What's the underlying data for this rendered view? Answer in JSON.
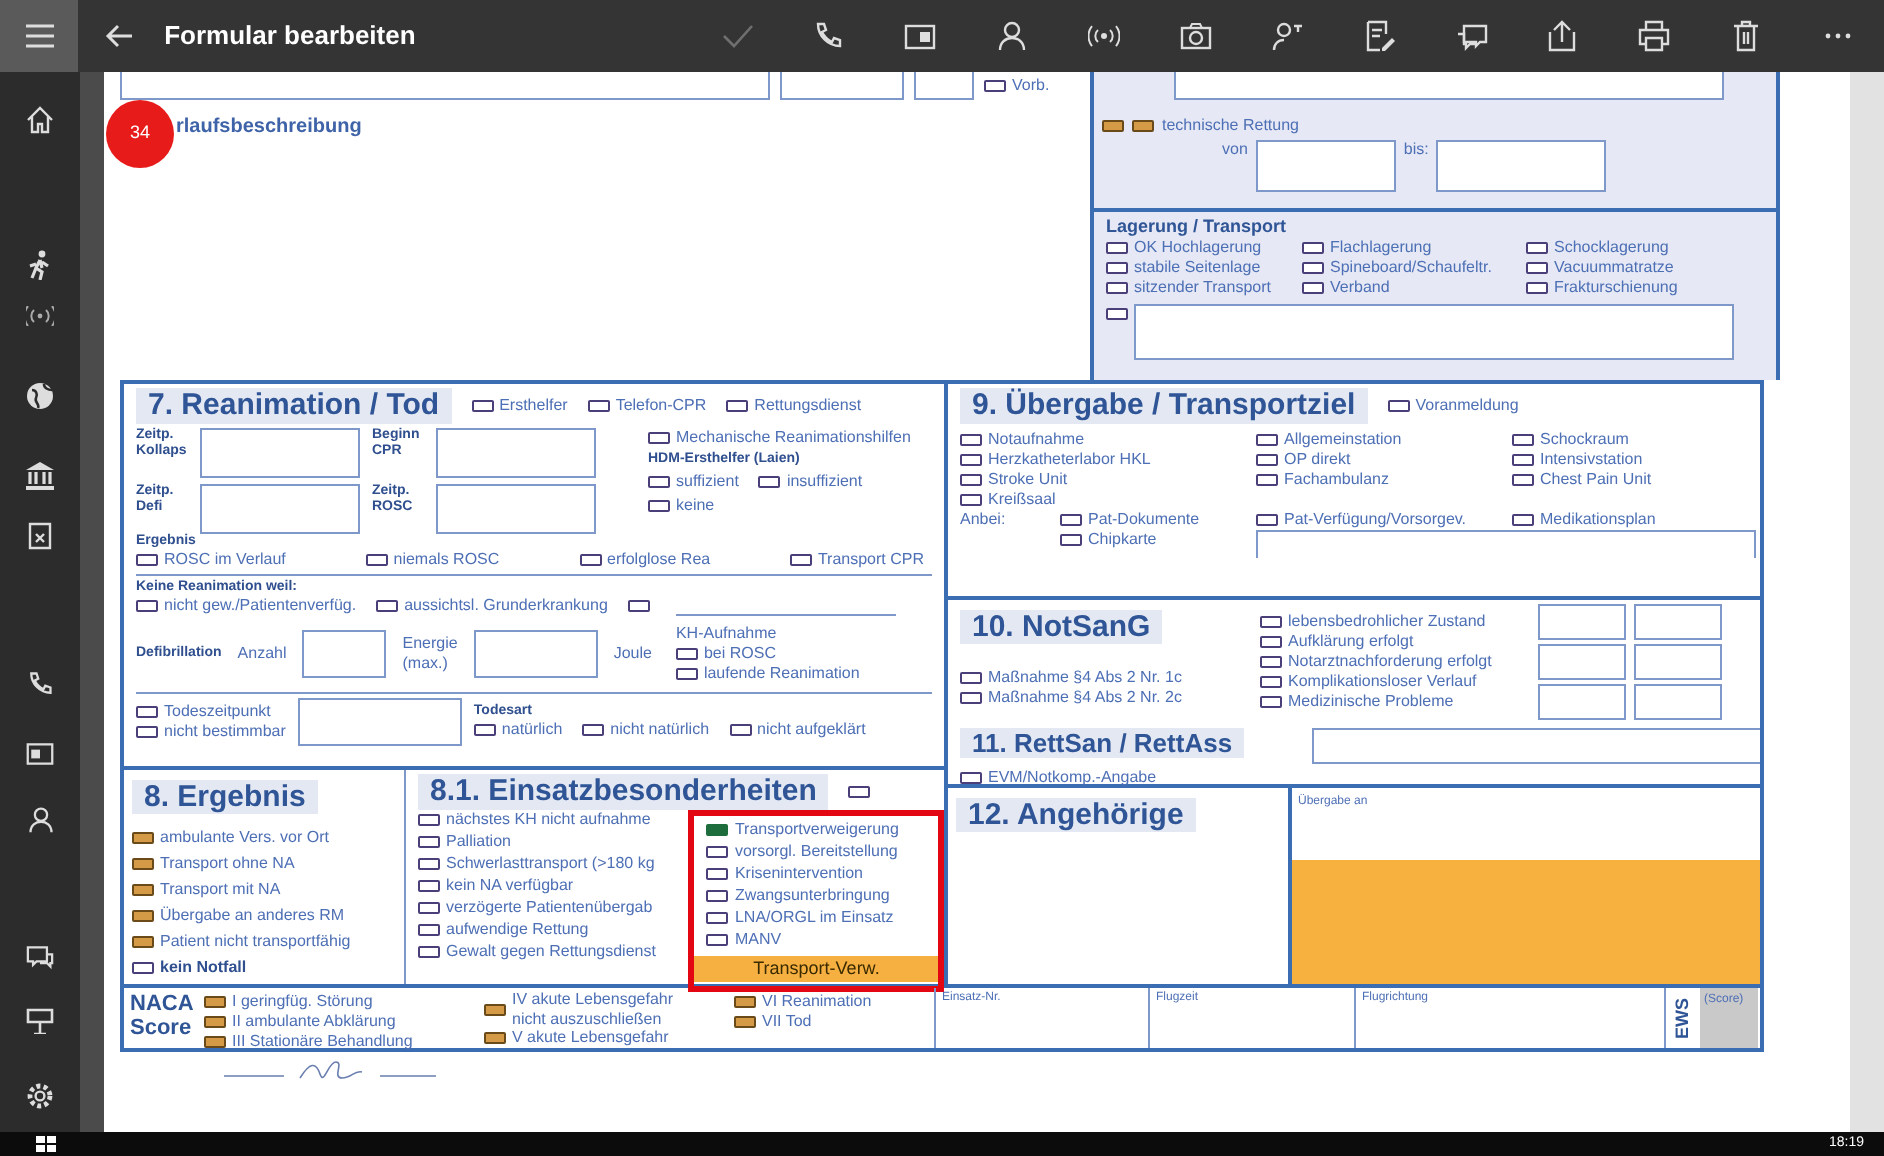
{
  "app_bar": {
    "title": "Formular bearbeiten",
    "confirm_disabled": true
  },
  "badge": "34",
  "top": {
    "title": "rlaufsbeschreibung",
    "vorb": {
      "label": "Vorb.",
      "checked": false
    },
    "technische_rettung": {
      "label": "technische Rettung",
      "boxes": [
        {
          "checked": false,
          "color": "#d49a45"
        },
        {
          "checked": false,
          "color": "#d49a45"
        }
      ],
      "from": "von",
      "to": "bis:"
    }
  },
  "lagerung": {
    "title": "Lagerung / Transport",
    "columns": [
      [
        {
          "label": "OK Hochlagerung",
          "checked": false
        },
        {
          "label": "stabile Seitenlage",
          "checked": false
        },
        {
          "label": "sitzender Transport",
          "checked": false
        }
      ],
      [
        {
          "label": "Flachlagerung",
          "checked": false
        },
        {
          "label": "Spineboard/Schaufeltr.",
          "checked": false
        },
        {
          "label": "Verband",
          "checked": false
        }
      ],
      [
        {
          "label": "Schocklagerung",
          "checked": false
        },
        {
          "label": "Vacuummatratze",
          "checked": false
        },
        {
          "label": "Frakturschienung",
          "checked": false
        }
      ]
    ],
    "other": {
      "checked": false
    }
  },
  "reanimation": {
    "title": "7. Reanimation / Tod",
    "header_options": [
      {
        "label": "Ersthelfer",
        "checked": false
      },
      {
        "label": "Telefon-CPR",
        "checked": false
      },
      {
        "label": "Rettungsdienst",
        "checked": false
      }
    ],
    "times": [
      "Zeitp.\nKollaps",
      "Beginn\nCPR",
      "Zeitp.\nDefi",
      "Zeitp.\nROSC"
    ],
    "mech": {
      "label": "Mechanische Reanimationshilfen",
      "checked": false
    },
    "hdm_title": "HDM-Ersthelfer (Laien)",
    "hdm": [
      {
        "label": "suffizient",
        "checked": false
      },
      {
        "label": "insuffizient",
        "checked": false
      },
      {
        "label": "keine",
        "checked": false
      }
    ],
    "result_title": "Ergebnis",
    "results": [
      {
        "label": "ROSC im Verlauf",
        "checked": false
      },
      {
        "label": "niemals ROSC",
        "checked": false
      },
      {
        "label": "erfolglose Rea",
        "checked": false
      },
      {
        "label": "Transport CPR",
        "checked": false
      }
    ],
    "no_rea_title": "Keine Reanimation weil:",
    "no_rea": [
      {
        "label": "nicht gew./Patientenverfüg.",
        "checked": false
      },
      {
        "label": "aussichtsl. Grunderkrankung",
        "checked": false
      },
      {
        "checked": false
      }
    ],
    "defi": {
      "title": "Defibrillation",
      "count": "Anzahl",
      "energy": "Energie\n(max.)",
      "unit": "Joule"
    },
    "kh": {
      "title": "KH-Aufnahme",
      "options": [
        {
          "label": "bei ROSC",
          "checked": false
        },
        {
          "label": "laufende Reanimation",
          "checked": false
        }
      ]
    },
    "death": {
      "options": [
        {
          "label": "Todeszeitpunkt",
          "checked": false
        },
        {
          "label": "nicht bestimmbar",
          "checked": false
        }
      ],
      "type_title": "Todesart",
      "types": [
        {
          "label": "natürlich",
          "checked": false
        },
        {
          "label": "nicht natürlich",
          "checked": false
        },
        {
          "label": "nicht aufgeklärt",
          "checked": false
        }
      ]
    }
  },
  "uebergabe": {
    "title": "9. Übergabe / Transportziel",
    "prenotice": {
      "label": "Voranmeldung",
      "checked": false
    },
    "columns": [
      [
        {
          "label": "Notaufnahme",
          "checked": false
        },
        {
          "label": "Herzkatheterlabor HKL",
          "checked": false
        },
        {
          "label": "Stroke Unit",
          "checked": false
        },
        {
          "label": "Kreißsaal",
          "checked": false
        }
      ],
      [
        {
          "label": "Allgemeinstation",
          "checked": false
        },
        {
          "label": "OP direkt",
          "checked": false
        },
        {
          "label": "Fachambulanz",
          "checked": false
        }
      ],
      [
        {
          "label": "Schockraum",
          "checked": false
        },
        {
          "label": "Intensivstation",
          "checked": false
        },
        {
          "label": "Chest Pain Unit",
          "checked": false
        }
      ]
    ],
    "attached_label": "Anbei:",
    "attached": [
      [
        {
          "label": "Pat-Dokumente",
          "checked": false
        },
        {
          "label": "Chipkarte",
          "checked": false
        }
      ],
      [
        {
          "label": "Pat-Verfügung/Vorsorgev.",
          "checked": false
        }
      ],
      [
        {
          "label": "Medikationsplan",
          "checked": false
        }
      ]
    ]
  },
  "notsang": {
    "title": "10. NotSanG",
    "measures": [
      {
        "label": "Maßnahme §4 Abs 2 Nr. 1c",
        "checked": false
      },
      {
        "label": "Maßnahme §4 Abs 2 Nr. 2c",
        "checked": false
      }
    ],
    "checks": [
      {
        "label": "lebensbedrohlicher Zustand",
        "checked": false
      },
      {
        "label": "Aufklärung erfolgt",
        "checked": false
      },
      {
        "label": "Notarztnachforderung erfolgt",
        "checked": false
      },
      {
        "label": "Komplikationsloser Verlauf",
        "checked": false
      },
      {
        "label": "Medizinische Probleme",
        "checked": false
      }
    ]
  },
  "rettsan": {
    "title": "11. RettSan / RettAss",
    "option": {
      "label": "EVM/Notkomp.-Angabe",
      "checked": false
    }
  },
  "ergebnis": {
    "title": "8. Ergebnis",
    "options": [
      {
        "label": "ambulante Vers. vor Ort",
        "checked": false,
        "color": "#d49a45",
        "bold": false
      },
      {
        "label": "Transport ohne NA",
        "checked": false,
        "color": "#d49a45",
        "bold": false
      },
      {
        "label": "Transport mit NA",
        "checked": false,
        "color": "#d49a45",
        "bold": false
      },
      {
        "label": "Übergabe an anderes RM",
        "checked": false,
        "color": "#d49a45",
        "bold": false
      },
      {
        "label": "Patient nicht transportfähig",
        "checked": false,
        "color": "#d49a45",
        "bold": false
      },
      {
        "label": "kein Notfall",
        "checked": false,
        "bold": true
      }
    ]
  },
  "besonderheiten": {
    "title": "8.1. Einsatzbesonderheiten",
    "none": {
      "checked": false
    },
    "left": [
      {
        "label": "nächstes KH nicht aufnahme",
        "checked": false
      },
      {
        "label": "Palliation",
        "checked": false
      },
      {
        "label": "Schwerlasttransport (>180 kg",
        "checked": false
      },
      {
        "label": "kein NA verfügbar",
        "checked": false
      },
      {
        "label": "verzögerte Patientenübergab",
        "checked": false
      },
      {
        "label": "aufwendige Rettung",
        "checked": false
      },
      {
        "label": "Gewalt gegen Rettungsdienst",
        "checked": false
      }
    ],
    "right": [
      {
        "label": "Transportverweigerung",
        "checked": true
      },
      {
        "label": "vorsorgl. Bereitstellung",
        "checked": false
      },
      {
        "label": "Krisenintervention",
        "checked": false
      },
      {
        "label": "Zwangsunterbringung",
        "checked": false
      },
      {
        "label": "LNA/ORGL im Einsatz",
        "checked": false
      },
      {
        "label": "MANV",
        "checked": false
      }
    ],
    "tag": "Transport-Verw."
  },
  "angehoerige": {
    "title": "12. Angehörige"
  },
  "handover": {
    "label": "Übergabe an"
  },
  "naca": {
    "title": "NACA\nScore",
    "columns": [
      [
        {
          "label": "I    geringfüg. Störung",
          "checked": false,
          "color": "#d49a45"
        },
        {
          "label": "II   ambulante Abklärung",
          "checked": false,
          "color": "#d49a45"
        },
        {
          "label": "III  Stationäre Behandlung",
          "checked": false,
          "color": "#d49a45"
        }
      ],
      [
        {
          "label": "IV  akute Lebensgefahr\n      nicht auszuschließen",
          "checked": false,
          "color": "#d49a45"
        },
        {
          "label": "V   akute Lebensgefahr",
          "checked": false,
          "color": "#d49a45"
        }
      ],
      [
        {
          "label": "VI  Reanimation",
          "checked": false,
          "color": "#d49a45"
        },
        {
          "label": "VII Tod",
          "checked": false,
          "color": "#d49a45"
        }
      ]
    ]
  },
  "footer_fields": [
    "Einsatz-Nr.",
    "Flugzeit",
    "Flugrichtung"
  ],
  "ews": {
    "label": "EWS",
    "score": "(Score)"
  },
  "taskbar": {
    "time": "18:19"
  }
}
